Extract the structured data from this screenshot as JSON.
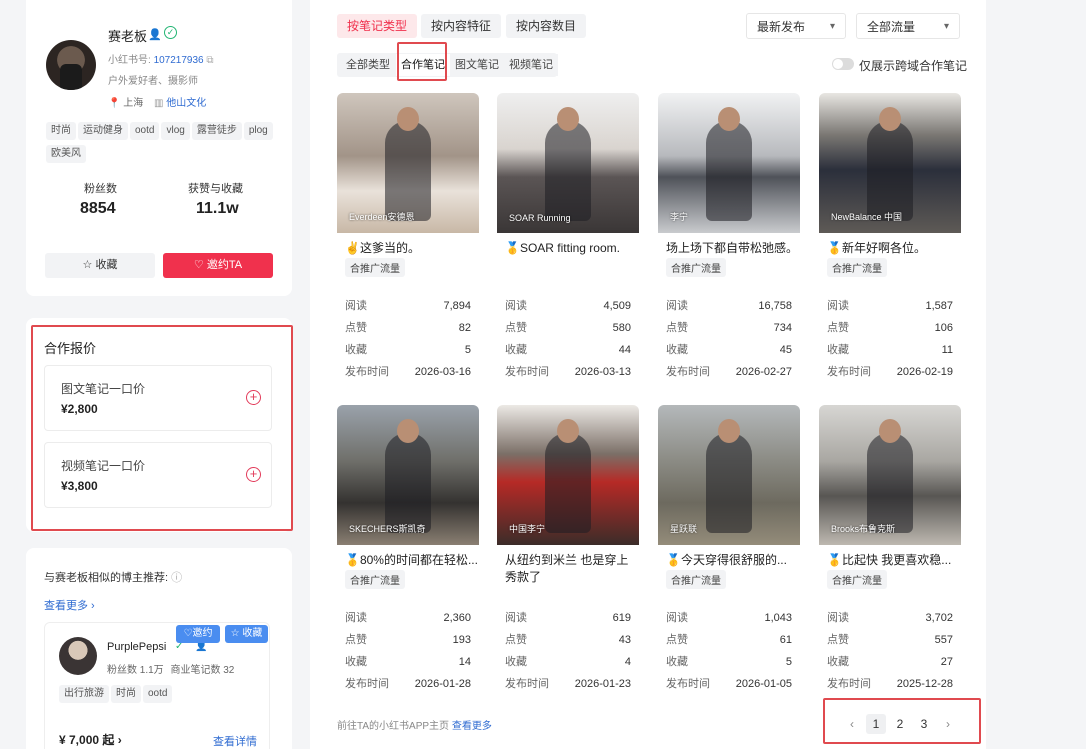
{
  "profile": {
    "name": "赛老板",
    "id_label": "小红书号:",
    "id_value": "107217936",
    "desc": "户外爱好者、摄影师",
    "location": "上海",
    "org": "他山文化",
    "tags": [
      "时尚",
      "运动健身",
      "ootd",
      "vlog",
      "露营徒步",
      "plog",
      "欧美风"
    ],
    "fans_label": "粉丝数",
    "fans_value": "8854",
    "likes_label": "获赞与收藏",
    "likes_value": "11.1w",
    "collect_btn": "收藏",
    "invite_btn": "邀约TA"
  },
  "pricing": {
    "title": "合作报价",
    "items": [
      {
        "label": "图文笔记一口价",
        "value": "¥2,800"
      },
      {
        "label": "视频笔记一口价",
        "value": "¥3,800"
      }
    ]
  },
  "similar": {
    "title": "与赛老板相似的博主推荐:",
    "more": "查看更多",
    "creator": {
      "name": "PurplePepsi",
      "fans": "粉丝数 1.1万",
      "notes": "商业笔记数 32",
      "tags": [
        "出行旅游",
        "时尚",
        "ootd"
      ],
      "invite": "邀约",
      "collect": "收藏",
      "price": "¥ 7,000 起",
      "detail": "查看详情"
    }
  },
  "tabs": {
    "primary": [
      "按笔记类型",
      "按内容特征",
      "按内容数目"
    ],
    "sort": "最新发布",
    "traffic": "全部流量",
    "secondary": [
      "全部类型",
      "合作笔记",
      "图文笔记",
      "视频笔记"
    ],
    "toggle_label": "仅展示跨域合作笔记"
  },
  "stat_labels": {
    "read": "阅读",
    "like": "点赞",
    "fav": "收藏",
    "date": "发布时间"
  },
  "notes": [
    {
      "title": "✌️这爹当的。",
      "brand": "Everdeen安德恩",
      "pill": "合推广流量",
      "read": "7,894",
      "like": "82",
      "fav": "5",
      "date": "2026-03-16",
      "medal": false,
      "twoLine": false,
      "pillShown": true
    },
    {
      "title": "🥇SOAR fitting room.",
      "brand": "SOAR Running",
      "pill": "",
      "read": "4,509",
      "like": "580",
      "fav": "44",
      "date": "2026-03-13",
      "medal": true,
      "twoLine": false,
      "pillShown": false
    },
    {
      "title": "场上场下都自带松弛感。",
      "brand": "李宁",
      "pill": "合推广流量",
      "read": "16,758",
      "like": "734",
      "fav": "45",
      "date": "2026-02-27",
      "medal": false,
      "twoLine": false,
      "pillShown": true
    },
    {
      "title": "🥇新年好啊各位。",
      "brand": "NewBalance 中国",
      "pill": "合推广流量",
      "read": "1,587",
      "like": "106",
      "fav": "11",
      "date": "2026-02-19",
      "medal": true,
      "twoLine": false,
      "pillShown": true
    },
    {
      "title": "🥇80%的时间都在轻松...",
      "brand": "SKECHERS斯凯奇",
      "pill": "合推广流量",
      "read": "2,360",
      "like": "193",
      "fav": "14",
      "date": "2026-01-28",
      "medal": true,
      "twoLine": false,
      "pillShown": true
    },
    {
      "title": "从纽约到米兰 也是穿上秀款了",
      "brand": "中国李宁",
      "pill": "",
      "read": "619",
      "like": "43",
      "fav": "4",
      "date": "2026-01-23",
      "medal": false,
      "twoLine": true,
      "pillShown": false
    },
    {
      "title": "🥇今天穿得很舒服的...",
      "brand": "星跃联",
      "pill": "合推广流量",
      "read": "1,043",
      "like": "61",
      "fav": "5",
      "date": "2026-01-05",
      "medal": true,
      "twoLine": false,
      "pillShown": true
    },
    {
      "title": "🥇比起快 我更喜欢稳...",
      "brand": "Brooks布鲁克斯",
      "pill": "合推广流量",
      "read": "3,702",
      "like": "557",
      "fav": "27",
      "date": "2025-12-28",
      "medal": true,
      "twoLine": false,
      "pillShown": true
    }
  ],
  "footer": {
    "text": "前往TA的小红书APP主页",
    "link": "查看更多"
  },
  "pagination": {
    "pages": [
      "1",
      "2",
      "3"
    ],
    "current": "1",
    "prev": "‹",
    "next": "›"
  },
  "colors": {
    "brand_red": "#f0314d",
    "highlight_box": "#e04a4f",
    "link_blue": "#2f6bd1"
  }
}
